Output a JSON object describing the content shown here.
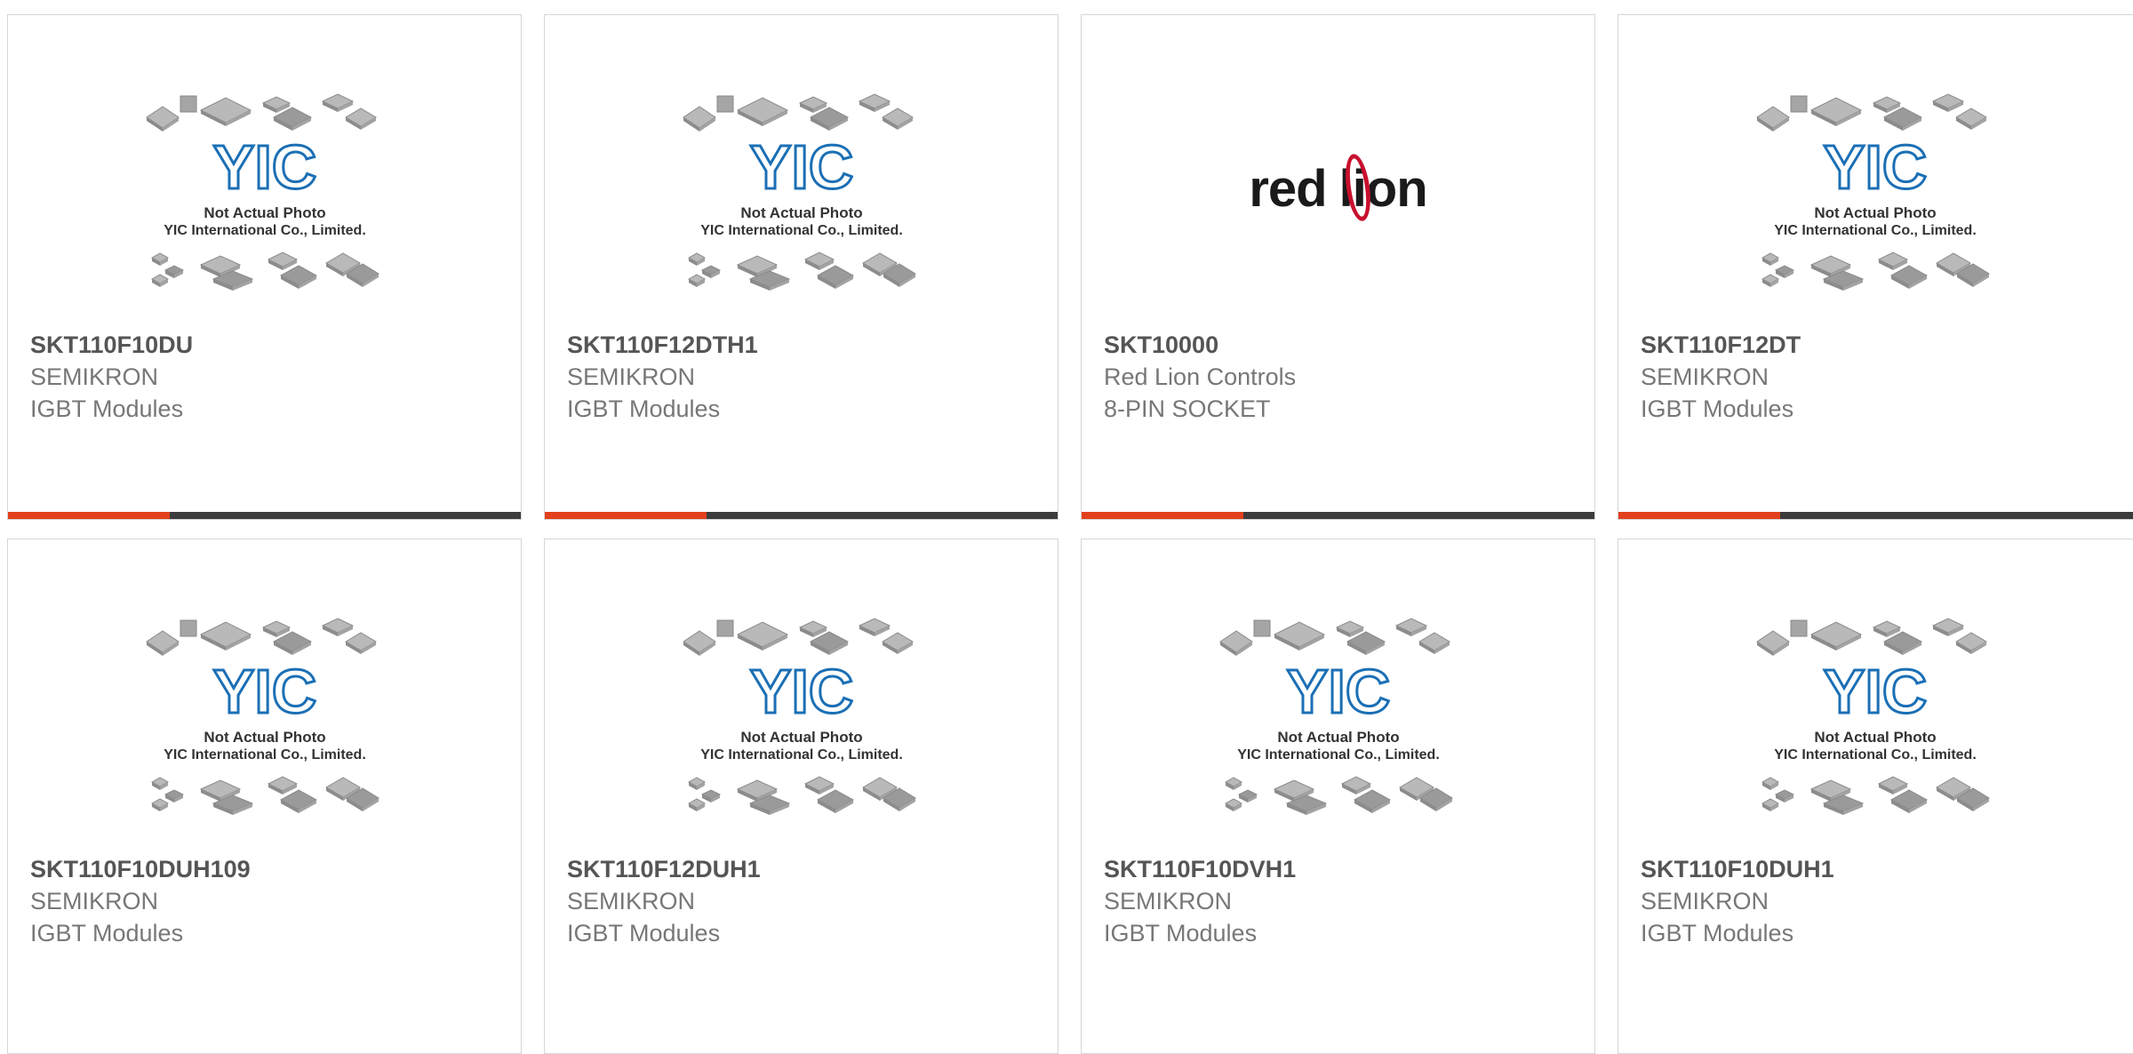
{
  "colors": {
    "accent": "#e2401c",
    "bar": "#3c3c3c",
    "part_text": "#555555",
    "meta_text": "#777777",
    "placeholder_logo": "#1b6fb5",
    "redlion_red": "#c8102e"
  },
  "placeholder": {
    "caption_line1": "Not Actual Photo",
    "caption_line2": "YIC International Co., Limited.",
    "logo_text": "YIC"
  },
  "redlion_logo": {
    "word1": "red",
    "word2": "lion"
  },
  "products": [
    {
      "part": "SKT110F10DU",
      "maker": "SEMIKRON",
      "category": "IGBT Modules",
      "image": "yic-placeholder"
    },
    {
      "part": "SKT110F12DTH1",
      "maker": "SEMIKRON",
      "category": "IGBT Modules",
      "image": "yic-placeholder"
    },
    {
      "part": "SKT10000",
      "maker": "Red Lion Controls",
      "category": "8-PIN SOCKET",
      "image": "redlion-logo"
    },
    {
      "part": "SKT110F12DT",
      "maker": "SEMIKRON",
      "category": "IGBT Modules",
      "image": "yic-placeholder"
    },
    {
      "part": "SKT110F10DUH109",
      "maker": "SEMIKRON",
      "category": "IGBT Modules",
      "image": "yic-placeholder"
    },
    {
      "part": "SKT110F12DUH1",
      "maker": "SEMIKRON",
      "category": "IGBT Modules",
      "image": "yic-placeholder"
    },
    {
      "part": "SKT110F10DVH1",
      "maker": "SEMIKRON",
      "category": "IGBT Modules",
      "image": "yic-placeholder"
    },
    {
      "part": "SKT110F10DUH1",
      "maker": "SEMIKRON",
      "category": "IGBT Modules",
      "image": "yic-placeholder"
    }
  ]
}
